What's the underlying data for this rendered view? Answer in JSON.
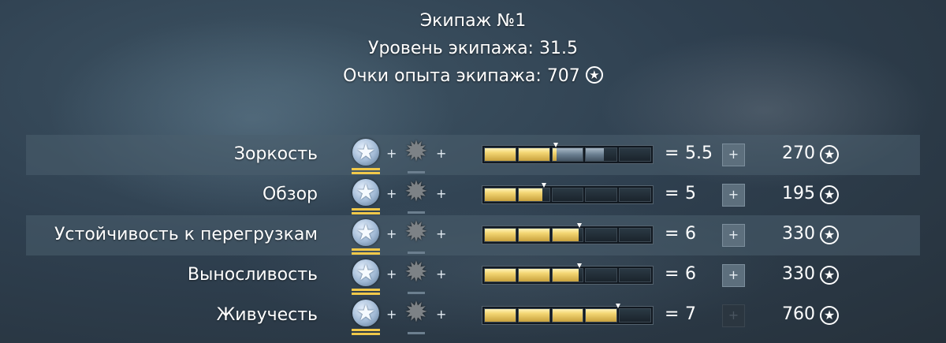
{
  "crew": {
    "title": "Экипаж №1",
    "level_label": "Уровень экипажа:",
    "level_value": "31.5",
    "exp_label": "Очки опыта экипажа:",
    "exp_value": "707",
    "exp_icon": "crew-points-icon"
  },
  "symbols": {
    "plus": "+",
    "equals": "="
  },
  "skills": [
    {
      "name": "Зоркость",
      "level": "5.5",
      "cost": "270",
      "button": "+",
      "button_enabled": true,
      "progress": 0.4286,
      "next_progress": 0.7143,
      "shaded": true
    },
    {
      "name": "Обзор",
      "level": "5",
      "cost": "195",
      "button": "+",
      "button_enabled": true,
      "progress": 0.3571,
      "next_progress": 0.3571,
      "shaded": false
    },
    {
      "name": "Устойчивость к перегрузкам",
      "level": "6",
      "cost": "330",
      "button": "+",
      "button_enabled": true,
      "progress": 0.5714,
      "next_progress": 0.5714,
      "shaded": true
    },
    {
      "name": "Выносливость",
      "level": "6",
      "cost": "330",
      "button": "+",
      "button_enabled": true,
      "progress": 0.5714,
      "next_progress": 0.5714,
      "shaded": false
    },
    {
      "name": "Живучесть",
      "level": "7",
      "cost": "760",
      "button": "+",
      "button_enabled": false,
      "progress": 0.8,
      "next_progress": 0.8,
      "shaded": false
    }
  ],
  "colors": {
    "gold": "#f3d673",
    "blue": "#6a7e90",
    "row_shade": "#4b5f6e",
    "button": "#5d6f7d"
  },
  "icons": {
    "qualification": "qualification-star-icon",
    "specialization": "specialization-star-icon",
    "cost": "crew-points-icon"
  }
}
